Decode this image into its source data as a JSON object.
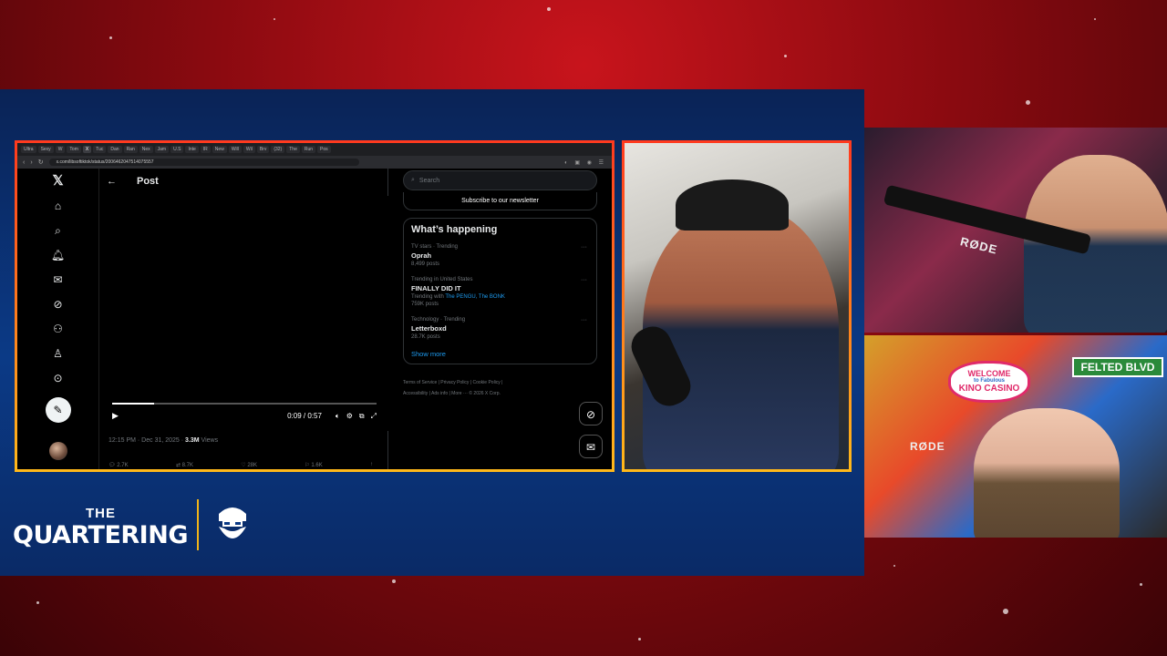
{
  "browser": {
    "tabs": [
      "Ultra",
      "Sexy",
      "W",
      "Tom",
      "X",
      "Tuc",
      "Dan",
      "Ran",
      "Nex",
      "Jam",
      "U.S",
      "Inte",
      "IR",
      "New",
      "Will",
      "Wil",
      "Brv",
      "(32)",
      "The",
      "Run",
      "Pos"
    ],
    "url": "x.com/libsoftiktok/status/2006462047514075557"
  },
  "x_app": {
    "nav_icons": [
      "x-logo",
      "home-icon",
      "search-icon",
      "bell-icon",
      "mail-icon",
      "grok-icon",
      "communities-icon",
      "profile-icon",
      "more-icon",
      "compose-icon"
    ],
    "post_header": "Post",
    "video": {
      "time": "0:09 / 0:57",
      "progress": 0.16
    },
    "post_meta": {
      "timestamp": "12:15 PM · Dec 31, 2025 · ",
      "views_count": "3.3M",
      "views_label": " Views"
    },
    "actions": [
      "2.7K",
      "8.7K",
      "28K",
      "1.6K",
      ""
    ],
    "search_placeholder": "Search",
    "newsletter": "Subscribe to our newsletter",
    "whats_happening": "What’s happening",
    "trends": [
      {
        "category": "TV stars · Trending",
        "name": "Oprah",
        "with": "",
        "with_links": "",
        "count": "8,499 posts"
      },
      {
        "category": "Trending in United States",
        "name": "FINALLY DID IT",
        "with": "Trending with ",
        "with_links": "The PENGU, The BONK",
        "count": "759K posts"
      },
      {
        "category": "Technology · Trending",
        "name": "Letterboxd",
        "with": "",
        "with_links": "",
        "count": "28.7K posts"
      }
    ],
    "show_more": "Show more",
    "footer_line1": "Terms of Service   |   Privacy Policy   |   Cookie Policy   |",
    "footer_line2": "Accessibility   |   Ads info   |   More ···   © 2026 X Corp."
  },
  "overlay": {
    "logo_the": "THE",
    "logo_main": "QUARTERING",
    "mic_brand": "RØDE",
    "sign_welcome": "WELCOME",
    "sign_fabulous": "to Fabulous",
    "sign_kino": "KINO CASINO",
    "sign_felted": "FELTED BLVD"
  },
  "colors": {
    "frame_top": "#ff3a1e",
    "frame_bottom": "#ffb81a",
    "x_link": "#1d9bf0",
    "stage_blue": "#0b3a86",
    "bg_red": "#c8141c"
  }
}
